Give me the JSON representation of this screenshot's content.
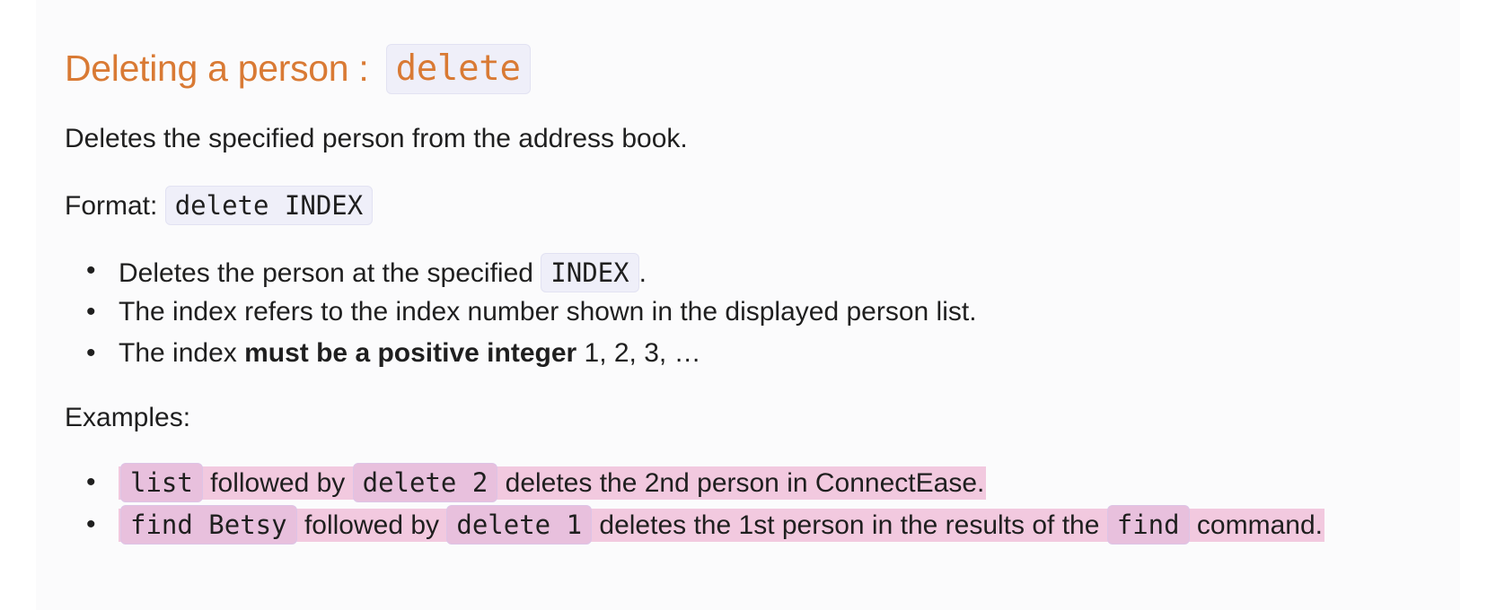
{
  "section": {
    "title_text": "Deleting a person : ",
    "title_code": "delete"
  },
  "description": "Deletes the specified person from the address book.",
  "format": {
    "label": "Format: ",
    "code": "delete INDEX"
  },
  "notes": {
    "item1": {
      "text_before": "Deletes the person at the specified ",
      "code": "INDEX",
      "text_after": "."
    },
    "item2": {
      "text": "The index refers to the index number shown in the displayed person list."
    },
    "item3": {
      "text_before": "The index ",
      "bold": "must be a positive integer",
      "text_after": " 1, 2, 3, …"
    }
  },
  "examples": {
    "label": "Examples:",
    "item1": {
      "code1": "list",
      "text1": " followed by ",
      "code2": "delete 2",
      "text2": " deletes the 2nd person in ConnectEase."
    },
    "item2": {
      "code1": "find Betsy",
      "text1": " followed by ",
      "code2": "delete 1",
      "text2": " deletes the 1st person in the results of the ",
      "code3": "find",
      "text3": " command."
    }
  },
  "colors": {
    "heading": "#d97a34",
    "code_background": "#efeff9",
    "highlight": "#f2c9df",
    "page_background": "#fbfbfc"
  }
}
